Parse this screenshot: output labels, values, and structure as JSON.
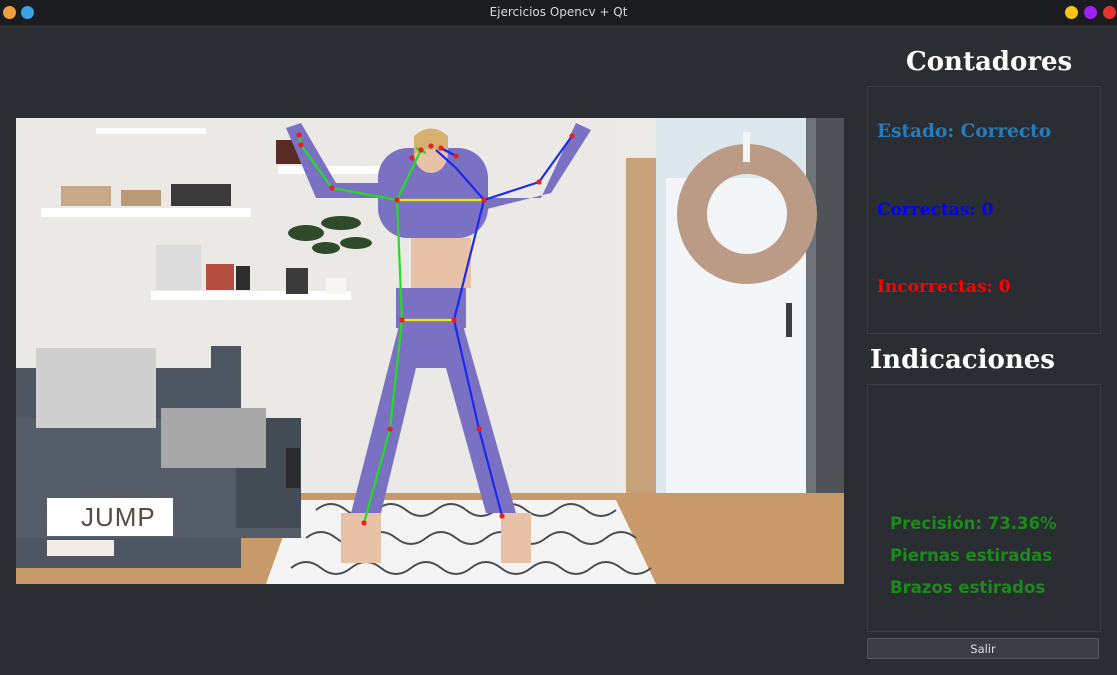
{
  "window": {
    "title": "Ejercicios Opencv + Qt",
    "colors": {
      "min": "#f5c518",
      "max": "#a020f0",
      "close": "#e0342c"
    }
  },
  "video": {
    "overlay_label": "JUMP"
  },
  "counters": {
    "title": "Contadores",
    "estado": "Estado: Correcto",
    "correctas": "Correctas: 0",
    "incorrectas": "Incorrectas: 0",
    "colors": {
      "estado": "#2a7ab8",
      "correctas": "#0000ff",
      "incorrectas": "#ff0000"
    }
  },
  "indications": {
    "title": "Indicaciones",
    "precision": "Precisión: 73.36%",
    "legs": "Piernas estiradas",
    "arms": "Brazos estirados"
  },
  "footer": {
    "exit_label": "Salir"
  }
}
